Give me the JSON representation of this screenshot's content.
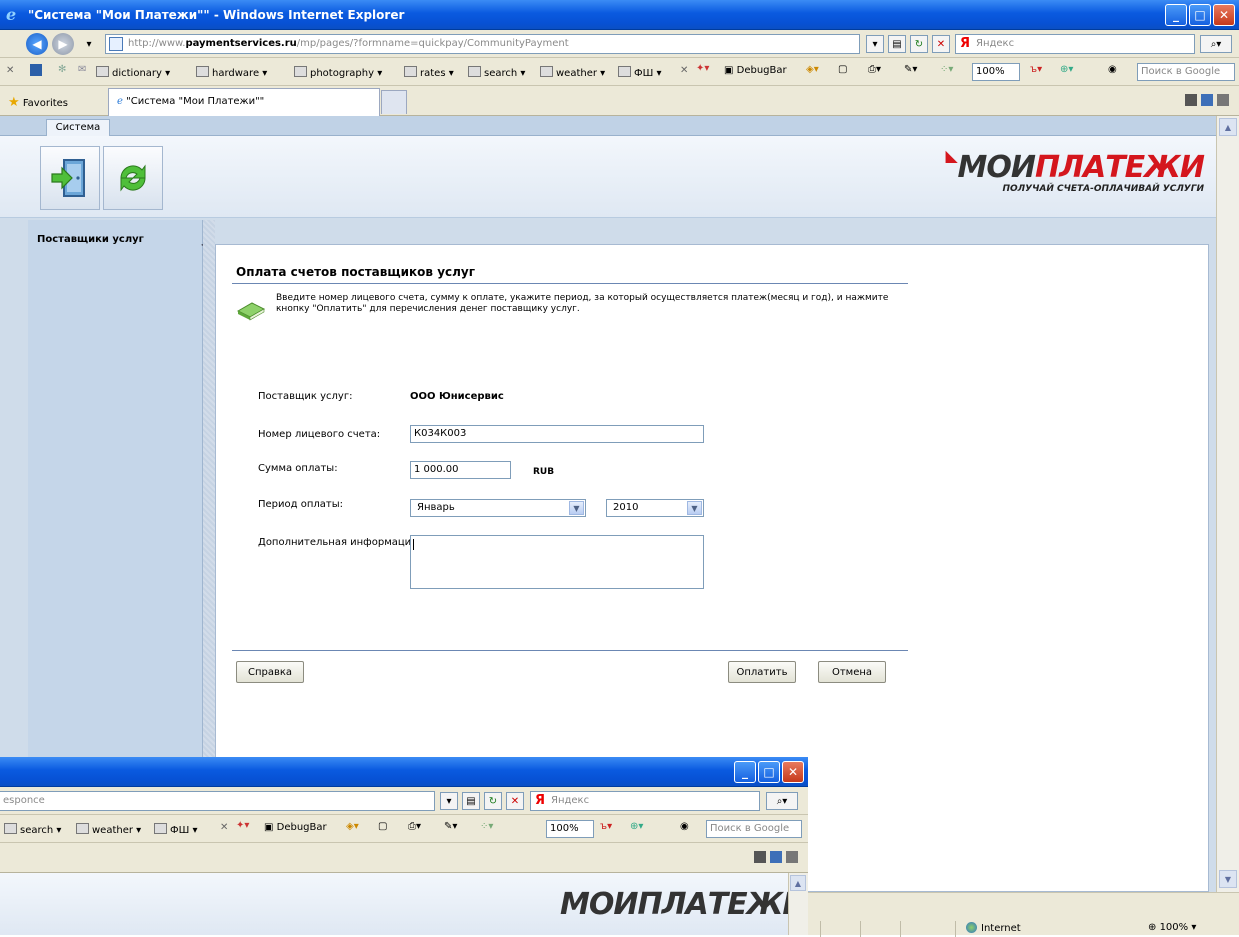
{
  "window": {
    "title": "\"Система \"Мои Платежи\"\" - Windows Internet Explorer",
    "url_prefix": "http://www.",
    "url_domain": "paymentservices.ru",
    "url_path": "/mp/pages/?formname=quickpay/CommunityPayment",
    "yandex_placeholder": "Яндекс",
    "google_placeholder": "Поиск в Google",
    "zoom_select": "100%",
    "favorites_label": "Favorites",
    "tab_label": "\"Система \"Мои Платежи\"\""
  },
  "linksbar": {
    "items": [
      "dictionary ▾",
      "hardware ▾",
      "photography ▾",
      "rates ▾",
      "search ▾",
      "weather ▾",
      "ФШ ▾"
    ],
    "debugbar": "DebugBar"
  },
  "app": {
    "system_tab": "Система",
    "logo_part1": "МОИ",
    "logo_part2": "ПЛАТЕЖИ",
    "logo_tagline": "ПОЛУЧАЙ СЧЕТА-ОПЛАЧИВАЙ УСЛУГИ",
    "sidebar_title": "Поставщики услуг"
  },
  "form": {
    "title": "Оплата счетов поставщиков услуг",
    "info_text": "Введите номер лицевого счета, сумму к оплате, укажите период, за который осуществляется платеж(месяц и год), и нажмите кнопку \"Оплатить\" для перечисления денег поставщику услуг.",
    "provider_label": "Поставщик услуг:",
    "provider_value": "ООО Юнисервис",
    "account_label": "Номер лицевого счета:",
    "account_value": "К034К003",
    "amount_label": "Сумма оплаты:",
    "amount_value": "1 000.00",
    "currency": "RUB",
    "period_label": "Период оплаты:",
    "month_value": "Январь",
    "year_value": "2010",
    "extra_label": "Дополнительная информация:",
    "help_button": "Справка",
    "pay_button": "Оплатить",
    "cancel_button": "Отмена"
  },
  "statusbar": {
    "zone": "Internet",
    "zoom": "100%"
  },
  "second_window": {
    "url_fragment": "esponce",
    "yandex_placeholder": "Яндекс",
    "google_placeholder": "Поиск в Google",
    "zoom_select": "100%",
    "links": [
      "search ▾",
      "weather ▾",
      "ФШ ▾"
    ],
    "debugbar": "DebugBar",
    "logo_partial": "МОИПЛАТЕЖИ"
  }
}
